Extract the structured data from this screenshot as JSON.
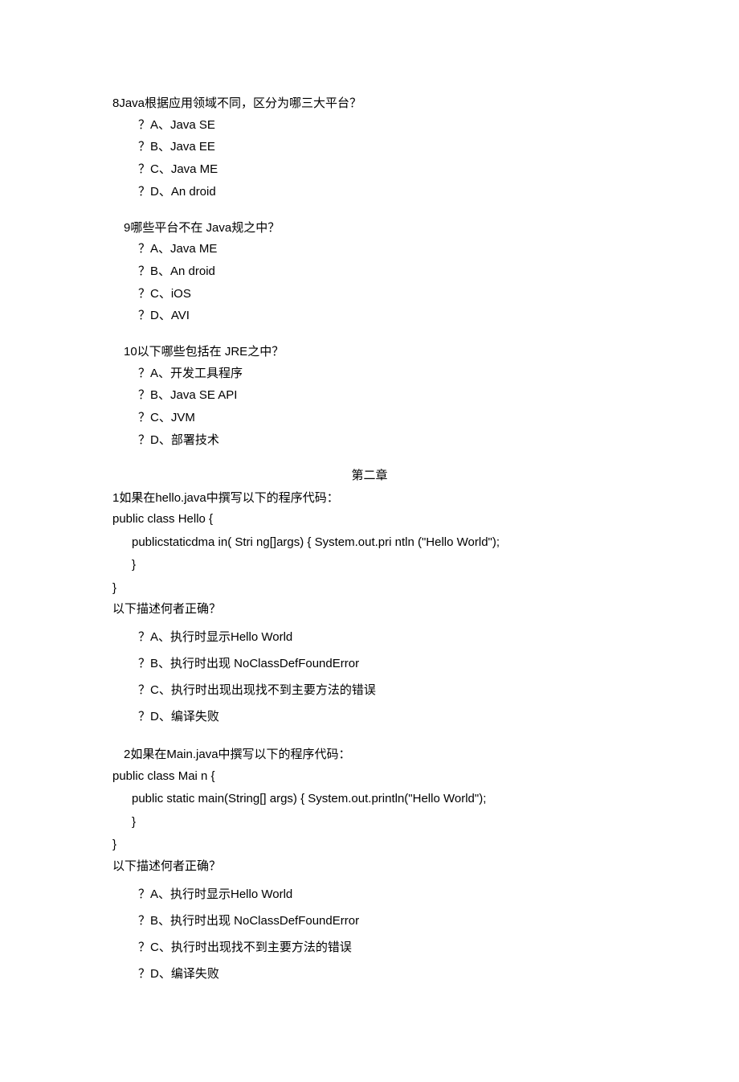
{
  "q8": {
    "text": "8Java根据应用领域不同，区分为哪三大平台？",
    "options": [
      "？A、Java SE",
      "？B、Java EE",
      "？C、Java ME",
      "？D、An droid"
    ]
  },
  "q9": {
    "text": "9哪些平台不在  Java规之中？",
    "options": [
      "？A、Java ME",
      "？B、An droid",
      "？C、iOS",
      "？D、AVI"
    ]
  },
  "q10": {
    "text": "10以下哪些包括在  JRE之中？",
    "options": [
      "？A、开发工具程序",
      "？B、Java SE API",
      "？C、JVM",
      "？D、部署技术"
    ]
  },
  "chapter2": "第二章",
  "q1": {
    "text": "1如果在hello.java中撰写以下的程序代码：",
    "code": {
      "l0": "public class Hello {",
      "l1": "publicstaticdma in( Stri ng[]args) { System.out.pri ntln (\"Hello World\");",
      "l2": "}",
      "l3": "}"
    },
    "follow": "以下描述何者正确？",
    "options": [
      "？A、执行时显示Hello World",
      "？B、执行时出现  NoClassDefFoundError",
      "？C、执行时出现出现找不到主要方法的错误",
      "？D、编译失败"
    ]
  },
  "q2": {
    "text": "2如果在Main.java中撰写以下的程序代码：",
    "code": {
      "l0": "public class Mai n {",
      "l1": "public static main(String[] args) { System.out.println(\"Hello World\");",
      "l2": "}",
      "l3": "}"
    },
    "follow": "以下描述何者正确？",
    "options": [
      "？A、执行时显示Hello World",
      "？B、执行时出现  NoClassDefFoundError",
      "？C、执行时出现找不到主要方法的错误",
      "？D、编译失败"
    ]
  }
}
